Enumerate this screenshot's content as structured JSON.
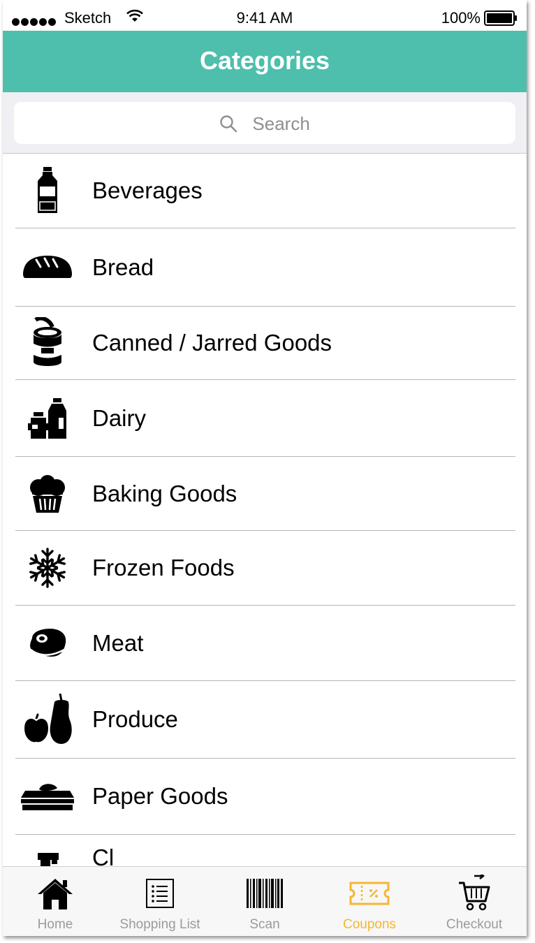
{
  "status_bar": {
    "carrier": "Sketch",
    "time": "9:41 AM",
    "battery": "100%"
  },
  "header": {
    "title": "Categories"
  },
  "search": {
    "placeholder": "Search"
  },
  "categories": [
    {
      "label": "Beverages",
      "icon": "bottle-icon"
    },
    {
      "label": "Bread",
      "icon": "bread-icon"
    },
    {
      "label": "Canned / Jarred Goods",
      "icon": "can-icon"
    },
    {
      "label": "Dairy",
      "icon": "dairy-icon"
    },
    {
      "label": "Baking Goods",
      "icon": "muffin-icon"
    },
    {
      "label": "Frozen Foods",
      "icon": "snowflake-icon"
    },
    {
      "label": "Meat",
      "icon": "steak-icon"
    },
    {
      "label": "Produce",
      "icon": "fruit-icon"
    },
    {
      "label": "Paper Goods",
      "icon": "tissue-box-icon"
    },
    {
      "label": "Cl",
      "icon": "spray-bottle-icon"
    }
  ],
  "tab_bar": {
    "active_color": "#f5b731",
    "items": [
      {
        "label": "Home",
        "icon": "home-icon"
      },
      {
        "label": "Shopping List",
        "icon": "list-icon"
      },
      {
        "label": "Scan",
        "icon": "barcode-icon"
      },
      {
        "label": "Coupons",
        "icon": "coupon-icon",
        "active": true
      },
      {
        "label": "Checkout",
        "icon": "cart-icon"
      }
    ]
  },
  "colors": {
    "header_bg": "#4dbfac",
    "header_text": "#ffffff"
  }
}
